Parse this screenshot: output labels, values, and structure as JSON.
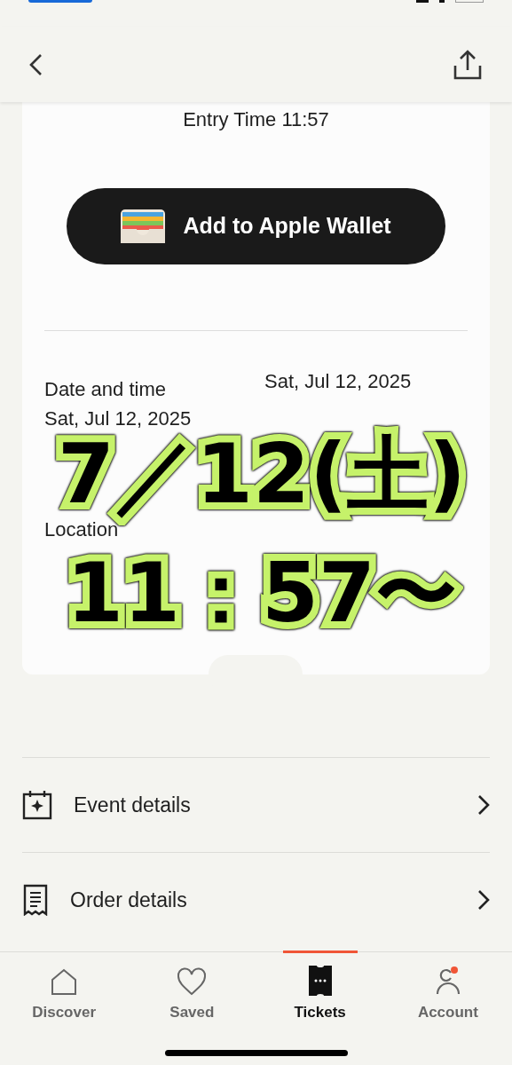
{
  "ticket": {
    "entry_time": "Entry Time 11:57",
    "wallet_button": "Add to Apple Wallet",
    "date_and_time": {
      "label": "Date and time",
      "start_date": "Sat, Jul 12, 2025",
      "end_date": "Sat, Jul 12, 2025"
    },
    "location": {
      "label": "Location"
    },
    "overlay": {
      "lines": [
        "7／12(土)",
        "11：57〜"
      ]
    }
  },
  "menu": [
    {
      "kind": "event",
      "label": "Event details"
    },
    {
      "kind": "order",
      "label": "Order details"
    }
  ],
  "tab_bar": [
    {
      "kind": "home",
      "label": "Discover",
      "selected": false
    },
    {
      "kind": "heart",
      "label": "Saved",
      "selected": false
    },
    {
      "kind": "ticket",
      "label": "Tickets",
      "selected": true
    },
    {
      "kind": "account",
      "label": "Account",
      "selected": false
    }
  ]
}
